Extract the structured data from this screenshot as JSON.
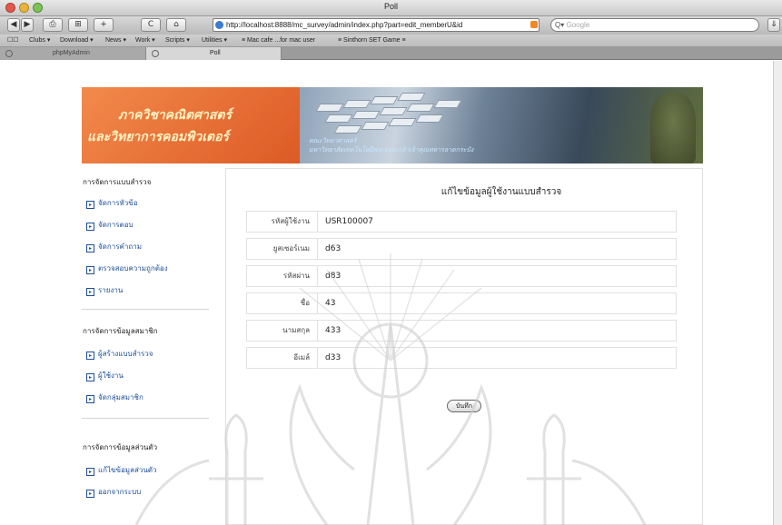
{
  "window": {
    "title": "Poll"
  },
  "toolbar": {
    "back_label": "◀",
    "forward_label": "▶",
    "print_label": "⎙",
    "bookmark_label": "⊞",
    "add_label": "+",
    "reload_label": "C",
    "home_label": "⌂",
    "address": "http://localhost:8888/mc_survey/admin/index.php?part=edit_memberU&id",
    "search_placeholder": "Google",
    "search_icon": "Q▾",
    "downloads_label": "⇓"
  },
  "bookmarks": {
    "icon": "☐☐",
    "items": [
      "Clubs ▾",
      "Download ▾",
      "News ▾",
      "Work ▾",
      "Scripts ▾",
      "Utilities ▾",
      "≡ Mac cafe ...for mac user",
      "≡ Sinthorn SET Game ≡"
    ]
  },
  "tabs": [
    {
      "label": "phpMyAdmin"
    },
    {
      "label": "Poll"
    }
  ],
  "banner": {
    "line1": "ภาควิชาคณิตศาสตร์",
    "line2": "และวิทยาการคอมพิวเตอร์",
    "caption1": "คณะวิทยาศาสตร์",
    "caption2": "มหาวิทยาลัยเทคโนโลยีพระจอมเกล้าเจ้าคุณทหารลาดกระบัง"
  },
  "sidebar": {
    "sections": [
      {
        "title": "การจัดการแบบสำรวจ",
        "items": [
          "จัดการหัวข้อ",
          "จัดการตอบ",
          "จัดการคำถาม",
          "ตรวจสอบความถูกต้อง",
          "รายงาน"
        ]
      },
      {
        "title": "การจัดการข้อมูลสมาชิก",
        "items": [
          "ผู้สร้างแบบสำรวจ",
          "ผู้ใช้งาน",
          "จัดกลุ่มสมาชิก"
        ]
      },
      {
        "title": "การจัดการข้อมูลส่วนตัว",
        "items": [
          "แก้ไขข้อมูลส่วนตัว",
          "ออกจากระบบ"
        ]
      }
    ]
  },
  "form": {
    "title": "แก้ไขข้อมูลผู้ใช้งานแบบสำรวจ",
    "fields": [
      {
        "label": "รหัสผู้ใช้งาน",
        "value": "USR100007"
      },
      {
        "label": "ยูสเซอร์เนม",
        "value": "d63"
      },
      {
        "label": "รหัสผ่าน",
        "value": "d83"
      },
      {
        "label": "ชื่อ",
        "value": "43"
      },
      {
        "label": "นามสกุล",
        "value": "433"
      },
      {
        "label": "อีเมล์",
        "value": "d33"
      }
    ],
    "save_label": "บันทึก"
  }
}
